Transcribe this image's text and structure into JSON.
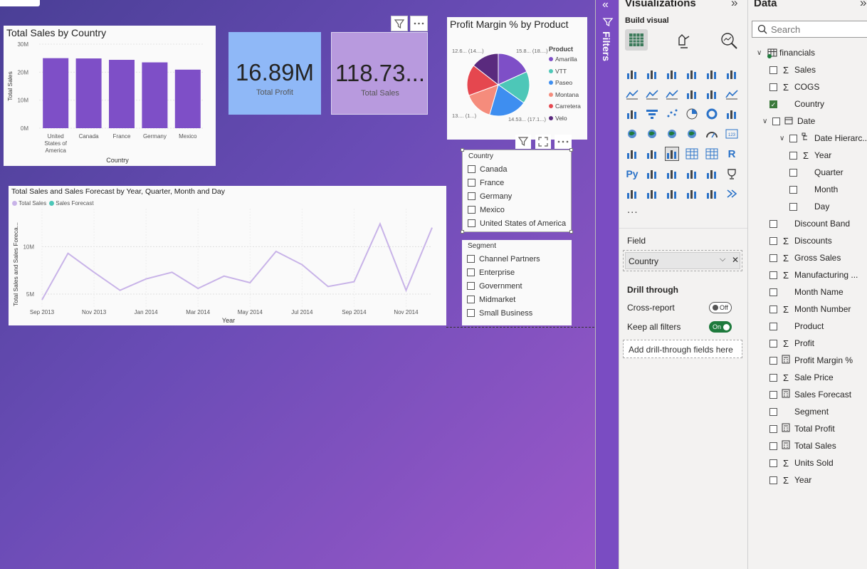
{
  "canvas": {
    "bar_chart": {
      "title": "Total Sales by Country",
      "ylabel": "Total Sales",
      "xlabel": "Country",
      "ticks": [
        "30M",
        "20M",
        "10M",
        "0M"
      ],
      "cat_labels": [
        [
          "United",
          "States of",
          "America"
        ],
        [
          "Canada"
        ],
        [
          "France"
        ],
        [
          "Germany"
        ],
        [
          "Mexico"
        ]
      ]
    },
    "kpi_profit": {
      "value": "16.89M",
      "label": "Total Profit"
    },
    "kpi_sales": {
      "value": "118.73...",
      "label": "Total Sales"
    },
    "pie_chart": {
      "title": "Profit Margin % by Product",
      "legend_title": "Product",
      "labels": {
        "top_left": "12.6... (14....)",
        "top_right": "15.8... (18....)",
        "bottom_left": "13.... (1...)",
        "bottom_right": "14.53... (17.1...)"
      }
    },
    "line_chart": {
      "title": "Total Sales and Sales Forecast by Year, Quarter, Month and Day",
      "legend": [
        "Total Sales",
        "Sales Forecast"
      ],
      "ylabel": "Total Sales and Sales Foreca...",
      "xlabel": "Year",
      "yticks": [
        "10M",
        "5M"
      ],
      "xticks": [
        "Sep 2013",
        "Nov 2013",
        "Jan 2014",
        "Mar 2014",
        "May 2014",
        "Jul 2014",
        "Sep 2014",
        "Nov 2014"
      ]
    },
    "country_slicer": {
      "title": "Country",
      "items": [
        "Canada",
        "France",
        "Germany",
        "Mexico",
        "United States of America"
      ]
    },
    "segment_slicer": {
      "title": "Segment",
      "items": [
        "Channel Partners",
        "Enterprise",
        "Government",
        "Midmarket",
        "Small Business"
      ]
    }
  },
  "chart_data": [
    {
      "type": "bar",
      "title": "Total Sales by Country",
      "xlabel": "Country",
      "ylabel": "Total Sales",
      "categories": [
        "United States of America",
        "Canada",
        "France",
        "Germany",
        "Mexico"
      ],
      "values": [
        25.0,
        24.9,
        24.4,
        23.5,
        20.9
      ],
      "ylim": [
        0,
        30
      ],
      "color": "#7e4fc7"
    },
    {
      "type": "pie",
      "title": "Profit Margin % by Product",
      "legend_title": "Product",
      "categories": [
        "Amarilla",
        "VTT",
        "Paseo",
        "Montana",
        "Carretera",
        "Velo"
      ],
      "values": [
        15.8,
        14.53,
        17.1,
        13.0,
        14.0,
        12.6
      ],
      "colors": [
        "#7e4fc7",
        "#4dc7b8",
        "#3e8ef0",
        "#f58c7c",
        "#e5474f",
        "#5a2a7e"
      ]
    },
    {
      "type": "line",
      "title": "Total Sales and Sales Forecast by Year, Quarter, Month and Day",
      "xlabel": "Year",
      "ylabel": "Total Sales and Sales Foreca...",
      "x": [
        "Sep 2013",
        "Oct 2013",
        "Nov 2013",
        "Dec 2013",
        "Jan 2014",
        "Feb 2014",
        "Mar 2014",
        "Apr 2014",
        "May 2014",
        "Jun 2014",
        "Jul 2014",
        "Aug 2014",
        "Sep 2014",
        "Oct 2014",
        "Nov 2014",
        "Dec 2014"
      ],
      "series": [
        {
          "name": "Total Sales",
          "values": [
            4.4,
            9.3,
            7.3,
            5.4,
            6.6,
            7.3,
            5.6,
            6.9,
            6.2,
            9.5,
            8.1,
            5.8,
            6.3,
            12.4,
            5.4,
            12.0
          ]
        }
      ],
      "ylim": [
        3.5,
        14
      ],
      "color": "#c8b3e8"
    }
  ],
  "filters_pane": {
    "label": "Filters"
  },
  "viz_pane": {
    "title": "Visualizations",
    "build_visual": "Build visual",
    "field_label": "Field",
    "field_value": "Country",
    "drill_through": "Drill through",
    "cross_report": "Cross-report",
    "cross_report_state": "Off",
    "keep_filters": "Keep all filters",
    "keep_filters_state": "On",
    "add_drill": "Add drill-through fields here",
    "more": "..."
  },
  "data_pane": {
    "title": "Data",
    "search_placeholder": "Search",
    "table": "financials",
    "fields": [
      {
        "label": "Sales",
        "sigma": true,
        "checked": false,
        "indent": 0
      },
      {
        "label": "COGS",
        "sigma": true,
        "checked": false,
        "indent": 0
      },
      {
        "label": "Country",
        "sigma": false,
        "checked": true,
        "indent": 0
      },
      {
        "label": "Date",
        "sigma": false,
        "checked": false,
        "indent": 0,
        "expand": true,
        "calendar": true
      },
      {
        "label": "Date Hierarc...",
        "sigma": false,
        "checked": false,
        "indent": 1,
        "expand": true,
        "hier": true
      },
      {
        "label": "Year",
        "sigma": true,
        "checked": false,
        "indent": 2
      },
      {
        "label": "Quarter",
        "sigma": false,
        "checked": false,
        "indent": 2
      },
      {
        "label": "Month",
        "sigma": false,
        "checked": false,
        "indent": 2
      },
      {
        "label": "Day",
        "sigma": false,
        "checked": false,
        "indent": 2
      },
      {
        "label": "Discount Band",
        "sigma": false,
        "checked": false,
        "indent": 0
      },
      {
        "label": "Discounts",
        "sigma": true,
        "checked": false,
        "indent": 0
      },
      {
        "label": "Gross Sales",
        "sigma": true,
        "checked": false,
        "indent": 0
      },
      {
        "label": "Manufacturing ...",
        "sigma": true,
        "checked": false,
        "indent": 0
      },
      {
        "label": "Month Name",
        "sigma": false,
        "checked": false,
        "indent": 0
      },
      {
        "label": "Month Number",
        "sigma": true,
        "checked": false,
        "indent": 0
      },
      {
        "label": "Product",
        "sigma": false,
        "checked": false,
        "indent": 0
      },
      {
        "label": "Profit",
        "sigma": true,
        "checked": false,
        "indent": 0
      },
      {
        "label": "Profit Margin %",
        "sigma": false,
        "checked": false,
        "indent": 0,
        "calc": true
      },
      {
        "label": "Sale Price",
        "sigma": true,
        "checked": false,
        "indent": 0
      },
      {
        "label": "Sales Forecast",
        "sigma": false,
        "checked": false,
        "indent": 0,
        "calc": true
      },
      {
        "label": "Segment",
        "sigma": false,
        "checked": false,
        "indent": 0
      },
      {
        "label": "Total Profit",
        "sigma": false,
        "checked": false,
        "indent": 0,
        "calc": true
      },
      {
        "label": "Total Sales",
        "sigma": false,
        "checked": false,
        "indent": 0,
        "calc": true
      },
      {
        "label": "Units Sold",
        "sigma": true,
        "checked": false,
        "indent": 0
      },
      {
        "label": "Year",
        "sigma": true,
        "checked": false,
        "indent": 0
      }
    ]
  }
}
